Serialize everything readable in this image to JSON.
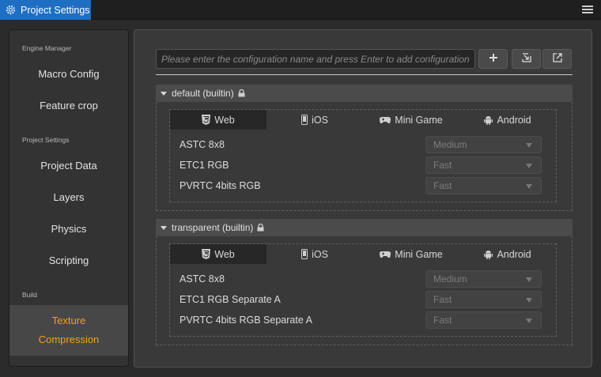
{
  "window": {
    "title": "Project Settings"
  },
  "sidebar": {
    "sections": [
      {
        "title": "Engine Manager"
      },
      {
        "title": "Project Settings"
      },
      {
        "title": "Build"
      }
    ],
    "items": [
      {
        "label": "Macro Config"
      },
      {
        "label": "Feature crop"
      },
      {
        "label": "Project Data"
      },
      {
        "label": "Layers"
      },
      {
        "label": "Physics"
      },
      {
        "label": "Scripting"
      }
    ],
    "active": {
      "line1": "Texture",
      "line2": "Compression"
    }
  },
  "toolbar": {
    "search_placeholder": "Please enter the configuration name and press Enter to add configuration",
    "add_icon": "plus-icon",
    "import_icon": "import-icon",
    "export_icon": "export-icon"
  },
  "platforms": {
    "web": "Web",
    "ios": "iOS",
    "minigame": "Mini Game",
    "android": "Android"
  },
  "groups": [
    {
      "title": "default (builtin)",
      "rows": [
        {
          "label": "ASTC 8x8",
          "value": "Medium"
        },
        {
          "label": "ETC1 RGB",
          "value": "Fast"
        },
        {
          "label": "PVRTC 4bits RGB",
          "value": "Fast"
        }
      ]
    },
    {
      "title": "transparent (builtin)",
      "rows": [
        {
          "label": "ASTC 8x8",
          "value": "Medium"
        },
        {
          "label": "ETC1 RGB Separate A",
          "value": "Fast"
        },
        {
          "label": "PVRTC 4bits RGB Separate A",
          "value": "Fast"
        }
      ]
    }
  ],
  "colors": {
    "accent": "#1e6fc4",
    "active_text": "#f0a020"
  }
}
